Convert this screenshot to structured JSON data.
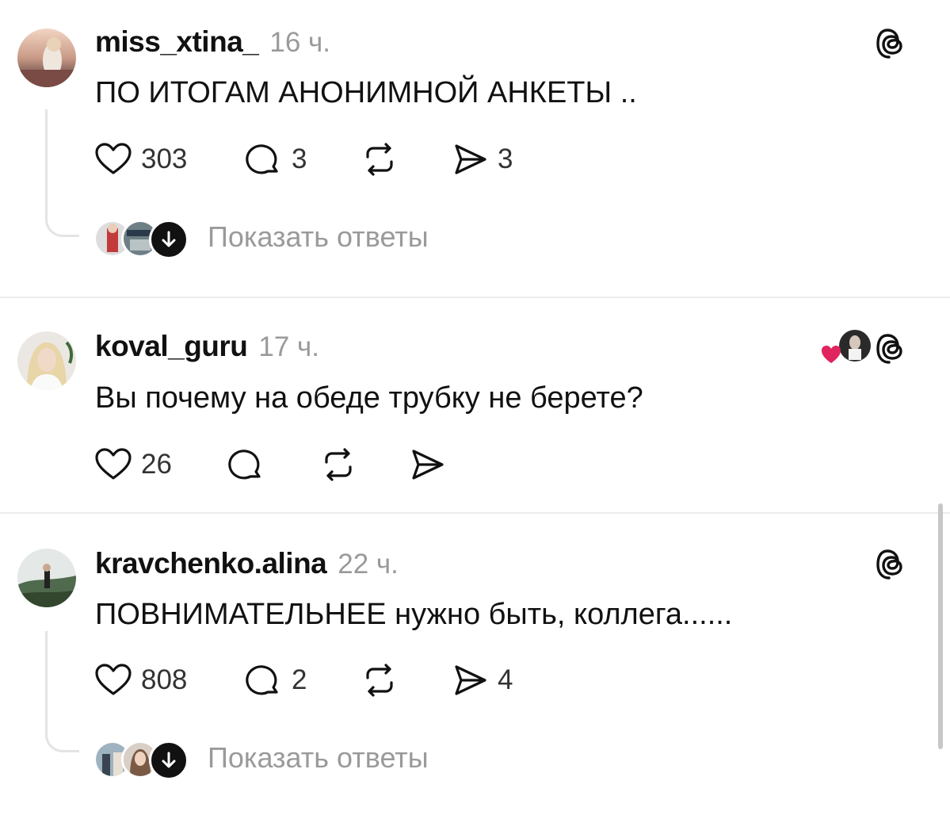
{
  "posts": [
    {
      "username": "miss_xtina_",
      "time": "16 ч.",
      "text": "ПО ИТОГАМ АНОНИМНОЙ АНКЕТЫ ..",
      "likes": "303",
      "comments": "3",
      "reposts": "",
      "shares": "3",
      "show_replies": "Показать ответы"
    },
    {
      "username": "koval_guru",
      "time": "17 ч.",
      "text": "Вы почему на обеде трубку не берете?",
      "likes": "26",
      "comments": "",
      "reposts": "",
      "shares": ""
    },
    {
      "username": "kravchenko.alina",
      "time": "22 ч.",
      "text": "ПОВНИМАТЕЛЬНЕЕ нужно быть, коллега......",
      "likes": "808",
      "comments": "2",
      "reposts": "",
      "shares": "4",
      "show_replies": "Показать ответы"
    }
  ],
  "icons": {
    "like": "heart-icon",
    "comment": "comment-bubble-icon",
    "repost": "repost-icon",
    "share": "send-icon",
    "brand": "threads-logo-icon",
    "expand": "arrow-down-icon"
  },
  "colors": {
    "text": "#111111",
    "muted": "#9a9a9a",
    "divider": "#ececec",
    "like_heart": "#e0245e"
  }
}
